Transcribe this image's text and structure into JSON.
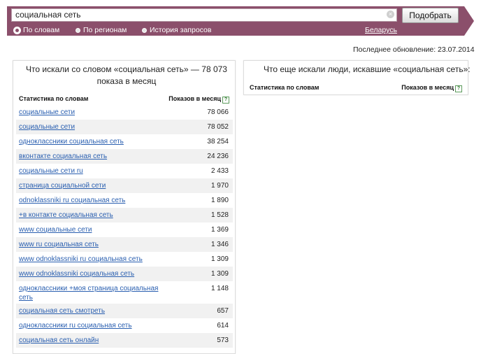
{
  "search": {
    "value": "социальная сеть",
    "clear_icon": "×",
    "submit_label": "Подобрать"
  },
  "modes": [
    {
      "label": "По словам",
      "checked": true
    },
    {
      "label": "По регионам",
      "checked": false
    },
    {
      "label": "История запросов",
      "checked": false
    }
  ],
  "region_label": "Беларусь",
  "last_update": "Последнее обновление: 23.07.2014",
  "left_panel": {
    "title": "Что искали со словом «социальная сеть» — 78 073 показа в месяц",
    "col_keyword": "Статистика по словам",
    "col_shows": "Показов в месяц",
    "rows": [
      {
        "keyword": "социальные сети",
        "count": "78 066"
      },
      {
        "keyword": "социальные сети",
        "count": "78 052"
      },
      {
        "keyword": "одноклассники социальная сеть",
        "count": "38 254"
      },
      {
        "keyword": "вконтакте социальная сеть",
        "count": "24 236"
      },
      {
        "keyword": "социальные сети ru",
        "count": "2 433"
      },
      {
        "keyword": "страница социальной сети",
        "count": "1 970"
      },
      {
        "keyword": "odnoklassniki ru социальная сеть",
        "count": "1 890"
      },
      {
        "keyword": "+в контакте социальная сеть",
        "count": "1 528"
      },
      {
        "keyword": "www социальные сети",
        "count": "1 369"
      },
      {
        "keyword": "www ru социальная сеть",
        "count": "1 346"
      },
      {
        "keyword": "www odnoklassniki ru социальная сеть",
        "count": "1 309"
      },
      {
        "keyword": "www odnoklassniki социальная сеть",
        "count": "1 309"
      },
      {
        "keyword": "одноклассники +моя страница социальная сеть",
        "count": "1 148"
      },
      {
        "keyword": "социальная сеть смотреть",
        "count": "657"
      },
      {
        "keyword": "одноклассники ru социальная сеть",
        "count": "614"
      },
      {
        "keyword": "социальная сеть онлайн",
        "count": "573"
      }
    ]
  },
  "right_panel": {
    "title": "Что еще искали люди, искавшие «социальная сеть»:",
    "col_keyword": "Статистика по словам",
    "col_shows": "Показов в месяц"
  },
  "help_icon": "?",
  "colors": {
    "header": "#8b4f6b",
    "link": "#2a5fb0",
    "alt_row": "#f1f1f1"
  }
}
